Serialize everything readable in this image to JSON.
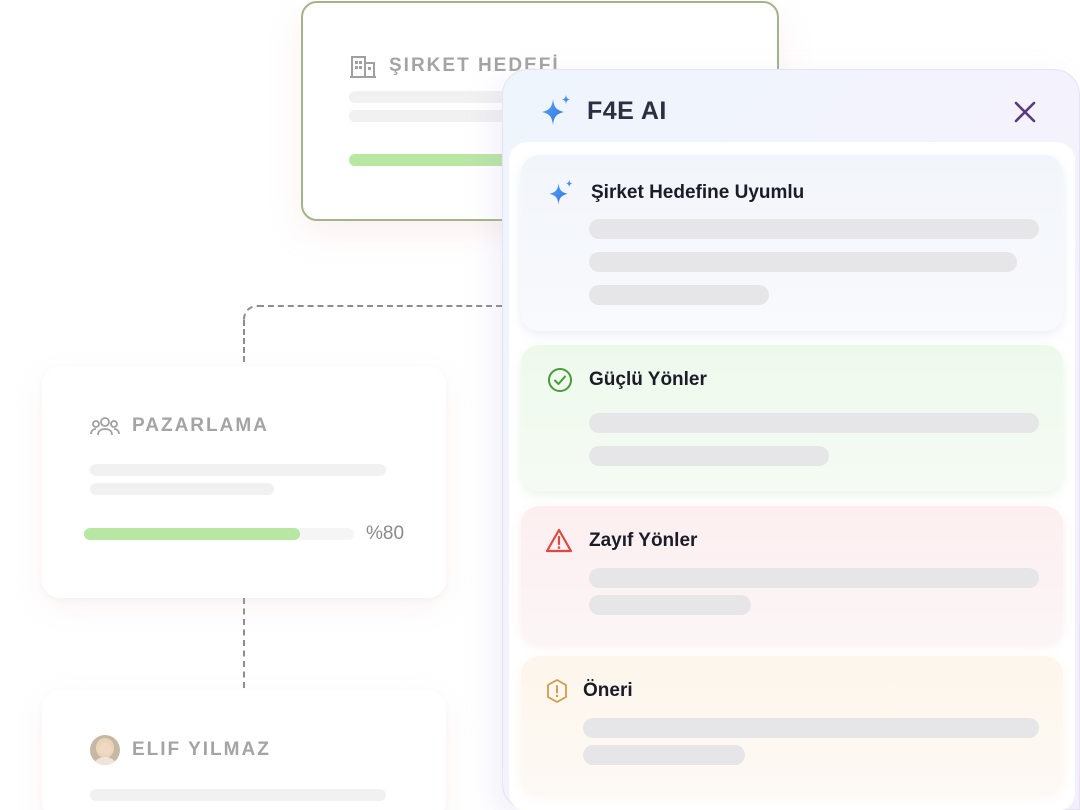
{
  "org_chart": {
    "company_card": {
      "title": "ŞIRKET HEDEFİ",
      "icon": "building-icon"
    },
    "department_card": {
      "title": "PAZARLAMA",
      "icon": "users-icon",
      "progress_value": 0.8,
      "progress_label": "%80"
    },
    "person_card": {
      "title": "ELIF YILMAZ",
      "icon": "avatar"
    }
  },
  "ai_panel": {
    "title": "F4E AI",
    "icon": "sparkle-icon",
    "close_icon": "close-icon",
    "sections": [
      {
        "title": "Şirket Hedefine Uyumlu",
        "icon": "sparkle-icon"
      },
      {
        "title": "Güçlü Yönler",
        "icon": "check-circle-icon",
        "color": "#4a9a3a"
      },
      {
        "title": "Zayıf Yönler",
        "icon": "warning-triangle-icon",
        "color": "#e0493f"
      },
      {
        "title": "Öneri",
        "icon": "info-hexagon-icon",
        "color": "#d19a4e"
      }
    ]
  },
  "colors": {
    "progress": "#b8e6a3",
    "company_border": "#a3b38a",
    "close": "#5b3a7a",
    "sparkle_blue": "#3a7fe8"
  }
}
